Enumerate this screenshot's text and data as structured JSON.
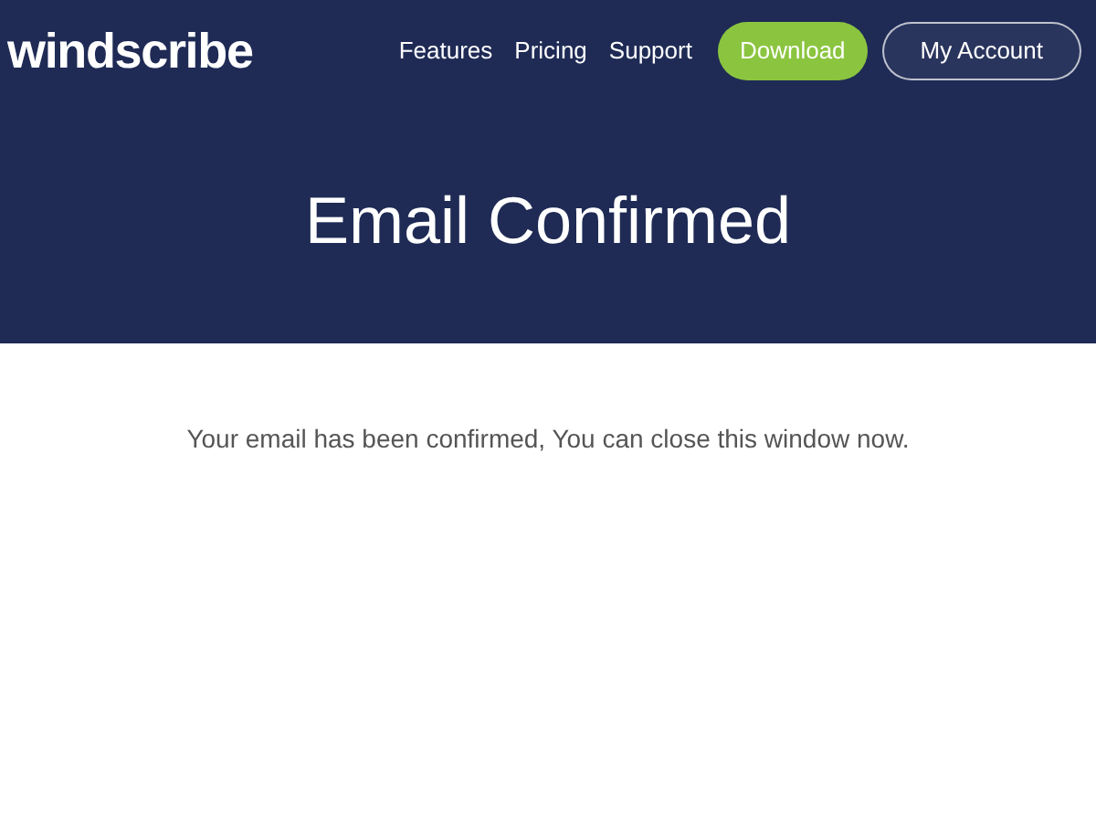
{
  "header": {
    "logo": "windscribe",
    "nav": [
      {
        "label": "Features"
      },
      {
        "label": "Pricing"
      },
      {
        "label": "Support"
      }
    ],
    "buttons": [
      {
        "label": "Download",
        "kind": "filled"
      },
      {
        "label": "My Account",
        "kind": "outline"
      }
    ],
    "title": "Email Confirmed"
  },
  "message": "Your email has been confirmed, You can close this window now."
}
